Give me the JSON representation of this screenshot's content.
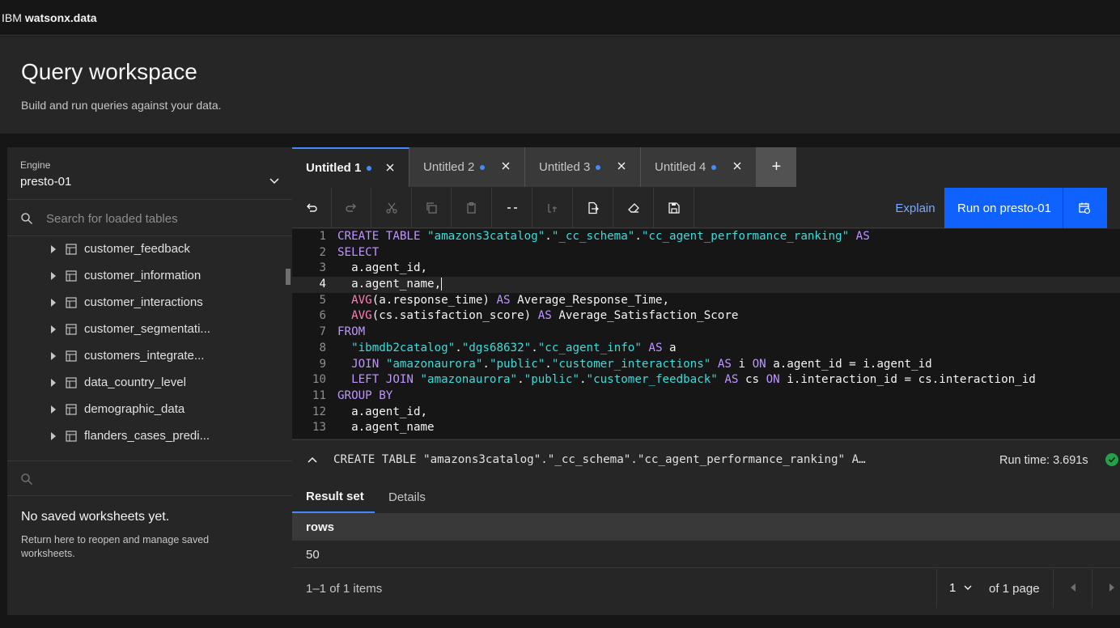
{
  "topbar": {
    "brand_prefix": "IBM",
    "brand_product": "watsonx.data"
  },
  "header": {
    "title": "Query workspace",
    "subtitle": "Build and run queries against your data."
  },
  "sidebar": {
    "engine_label": "Engine",
    "engine_value": "presto-01",
    "table_search_placeholder": "Search for loaded tables",
    "tables": [
      "customer_feedback",
      "customer_information",
      "customer_interactions",
      "customer_segmentati...",
      "customers_integrate...",
      "data_country_level",
      "demographic_data",
      "flanders_cases_predi..."
    ],
    "worksheets_empty_title": "No saved worksheets yet.",
    "worksheets_empty_body": "Return here to reopen and manage saved worksheets."
  },
  "tabs": [
    {
      "label": "Untitled 1",
      "active": true
    },
    {
      "label": "Untitled 2",
      "active": false
    },
    {
      "label": "Untitled 3",
      "active": false
    },
    {
      "label": "Untitled 4",
      "active": false
    }
  ],
  "add_tab_label": "+",
  "toolbar": {
    "icons": [
      "undo-icon",
      "redo-icon",
      "cut-icon",
      "copy-icon",
      "paste-icon",
      "comment-icon",
      "format-icon",
      "export-icon",
      "clear-icon",
      "save-icon"
    ],
    "explain_label": "Explain",
    "run_label": "Run on presto-01"
  },
  "editor": {
    "lines": [
      [
        [
          "kw",
          "CREATE TABLE "
        ],
        [
          "st",
          "\"amazons3catalog\""
        ],
        [
          "p",
          "."
        ],
        [
          "st",
          "\"_cc_schema\""
        ],
        [
          "p",
          "."
        ],
        [
          "st",
          "\"cc_agent_performance_ranking\""
        ],
        [
          "kw",
          " AS"
        ]
      ],
      [
        [
          "kw",
          "SELECT"
        ]
      ],
      [
        [
          "p",
          "  a.agent_id,"
        ]
      ],
      [
        [
          "p",
          "  a.agent_name,"
        ]
      ],
      [
        [
          "p",
          "  "
        ],
        [
          "fn",
          "AVG"
        ],
        [
          "p",
          "(a.response_time) "
        ],
        [
          "kw",
          "AS"
        ],
        [
          "p",
          " Average_Response_Time,"
        ]
      ],
      [
        [
          "p",
          "  "
        ],
        [
          "fn",
          "AVG"
        ],
        [
          "p",
          "(cs.satisfaction_score) "
        ],
        [
          "kw",
          "AS"
        ],
        [
          "p",
          " Average_Satisfaction_Score"
        ]
      ],
      [
        [
          "kw",
          "FROM"
        ]
      ],
      [
        [
          "p",
          "  "
        ],
        [
          "st",
          "\"ibmdb2catalog\""
        ],
        [
          "p",
          "."
        ],
        [
          "st",
          "\"dgs68632\""
        ],
        [
          "p",
          "."
        ],
        [
          "st",
          "\"cc_agent_info\""
        ],
        [
          "kw",
          " AS"
        ],
        [
          "p",
          " a"
        ]
      ],
      [
        [
          "p",
          "  "
        ],
        [
          "kw",
          "JOIN "
        ],
        [
          "st",
          "\"amazonaurora\""
        ],
        [
          "p",
          "."
        ],
        [
          "st",
          "\"public\""
        ],
        [
          "p",
          "."
        ],
        [
          "st",
          "\"customer_interactions\""
        ],
        [
          "kw",
          " AS"
        ],
        [
          "p",
          " i "
        ],
        [
          "kw",
          "ON"
        ],
        [
          "p",
          " a.agent_id = i.agent_id"
        ]
      ],
      [
        [
          "p",
          "  "
        ],
        [
          "kw",
          "LEFT JOIN "
        ],
        [
          "st",
          "\"amazonaurora\""
        ],
        [
          "p",
          "."
        ],
        [
          "st",
          "\"public\""
        ],
        [
          "p",
          "."
        ],
        [
          "st",
          "\"customer_feedback\""
        ],
        [
          "kw",
          " AS"
        ],
        [
          "p",
          " cs "
        ],
        [
          "kw",
          "ON"
        ],
        [
          "p",
          " i.interaction_id = cs.interaction_id"
        ]
      ],
      [
        [
          "kw",
          "GROUP BY"
        ]
      ],
      [
        [
          "p",
          "  a.agent_id,"
        ]
      ],
      [
        [
          "p",
          "  a.agent_name"
        ]
      ]
    ],
    "active_line": 4
  },
  "result": {
    "query_preview": "CREATE TABLE \"amazons3catalog\".\"_cc_schema\".\"cc_agent_performance_ranking\" A…",
    "run_time": "Run time: 3.691s",
    "tabs": [
      "Result set",
      "Details"
    ],
    "column": "rows",
    "value": "50",
    "items_text": "1–1 of 1 items",
    "page_select": "1",
    "of_pages": "of 1 page"
  },
  "colors": {
    "accent": "#0f62fe",
    "link": "#78a9ff",
    "success": "#24a148"
  }
}
